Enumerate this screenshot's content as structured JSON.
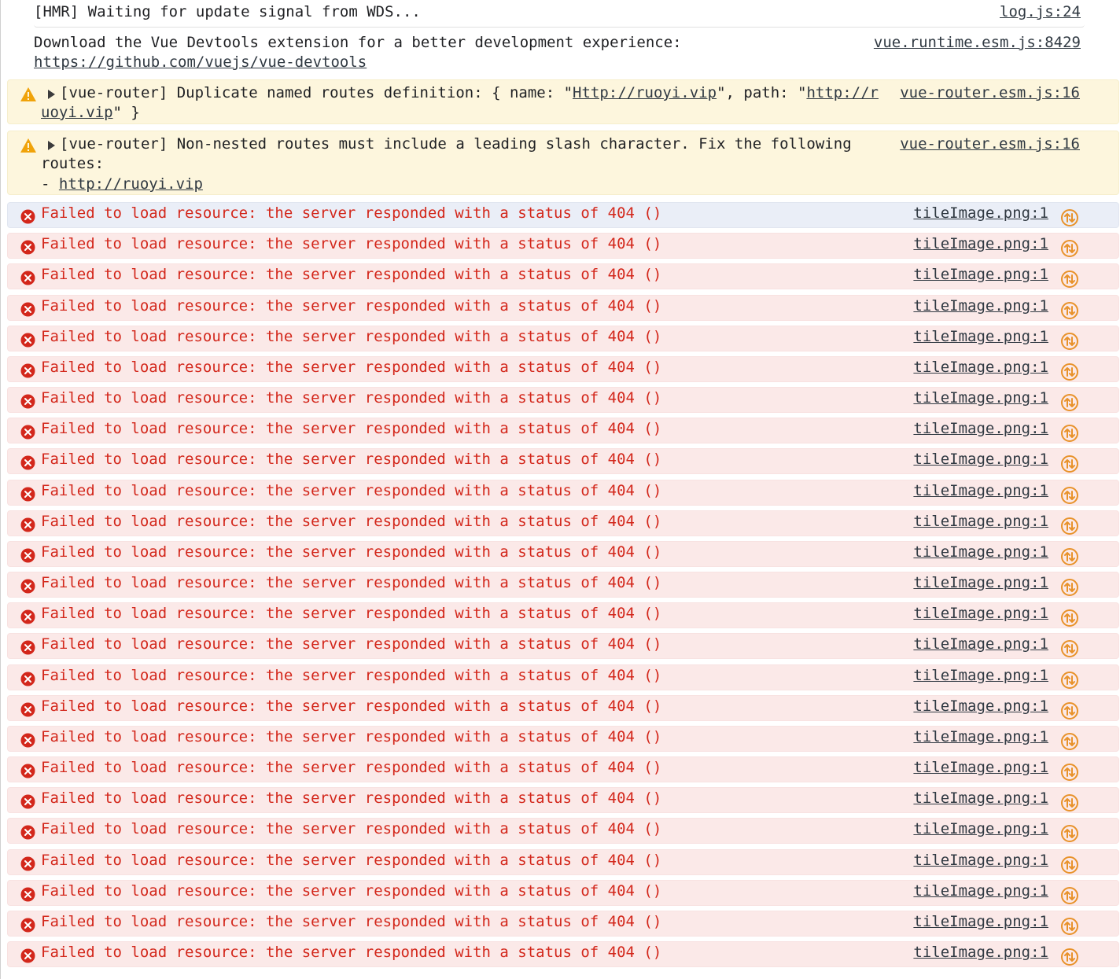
{
  "colors": {
    "error_text": "#d3271b",
    "error_bg": "#fbe9e8",
    "warning_bg": "#fdf6dd",
    "selected_bg": "#eaeef7",
    "warning_icon": "#f0a30a",
    "network_icon": "#e8922a"
  },
  "messages": {
    "hmr": {
      "text": "[HMR] Waiting for update signal from WDS...",
      "source": "log.js:24"
    },
    "devtools": {
      "text": "Download the Vue Devtools extension for a better development experience:",
      "link": "https://github.com/vuejs/vue-devtools",
      "source": "vue.runtime.esm.js:8429"
    },
    "warn_duplicate": {
      "icon": "warning-icon",
      "prefix": "[vue-router] Duplicate named routes definition: { name: \"",
      "link1": "Http://ruoyi.vip",
      "middle": "\", path: \"",
      "link2a": "http://r",
      "link2b": "uoyi.vip",
      "suffix": "\" }",
      "source": "vue-router.esm.js:16"
    },
    "warn_slash": {
      "icon": "warning-icon",
      "line1": "[vue-router] Non-nested routes must include a leading slash character. Fix the following",
      "line2": "routes:",
      "line3_prefix": "- ",
      "line3_link": "http://ruoyi.vip",
      "source": "vue-router.esm.js:16"
    }
  },
  "errors": [
    {
      "text": "Failed to load resource: the server responded with a status of 404 ()",
      "source": "tileImage.png:1"
    },
    {
      "text": "Failed to load resource: the server responded with a status of 404 ()",
      "source": "tileImage.png:1"
    },
    {
      "text": "Failed to load resource: the server responded with a status of 404 ()",
      "source": "tileImage.png:1"
    },
    {
      "text": "Failed to load resource: the server responded with a status of 404 ()",
      "source": "tileImage.png:1"
    },
    {
      "text": "Failed to load resource: the server responded with a status of 404 ()",
      "source": "tileImage.png:1"
    },
    {
      "text": "Failed to load resource: the server responded with a status of 404 ()",
      "source": "tileImage.png:1"
    },
    {
      "text": "Failed to load resource: the server responded with a status of 404 ()",
      "source": "tileImage.png:1"
    },
    {
      "text": "Failed to load resource: the server responded with a status of 404 ()",
      "source": "tileImage.png:1"
    },
    {
      "text": "Failed to load resource: the server responded with a status of 404 ()",
      "source": "tileImage.png:1"
    },
    {
      "text": "Failed to load resource: the server responded with a status of 404 ()",
      "source": "tileImage.png:1"
    },
    {
      "text": "Failed to load resource: the server responded with a status of 404 ()",
      "source": "tileImage.png:1"
    },
    {
      "text": "Failed to load resource: the server responded with a status of 404 ()",
      "source": "tileImage.png:1"
    },
    {
      "text": "Failed to load resource: the server responded with a status of 404 ()",
      "source": "tileImage.png:1"
    },
    {
      "text": "Failed to load resource: the server responded with a status of 404 ()",
      "source": "tileImage.png:1"
    },
    {
      "text": "Failed to load resource: the server responded with a status of 404 ()",
      "source": "tileImage.png:1"
    },
    {
      "text": "Failed to load resource: the server responded with a status of 404 ()",
      "source": "tileImage.png:1"
    },
    {
      "text": "Failed to load resource: the server responded with a status of 404 ()",
      "source": "tileImage.png:1"
    },
    {
      "text": "Failed to load resource: the server responded with a status of 404 ()",
      "source": "tileImage.png:1"
    },
    {
      "text": "Failed to load resource: the server responded with a status of 404 ()",
      "source": "tileImage.png:1"
    },
    {
      "text": "Failed to load resource: the server responded with a status of 404 ()",
      "source": "tileImage.png:1"
    },
    {
      "text": "Failed to load resource: the server responded with a status of 404 ()",
      "source": "tileImage.png:1"
    },
    {
      "text": "Failed to load resource: the server responded with a status of 404 ()",
      "source": "tileImage.png:1"
    },
    {
      "text": "Failed to load resource: the server responded with a status of 404 ()",
      "source": "tileImage.png:1"
    },
    {
      "text": "Failed to load resource: the server responded with a status of 404 ()",
      "source": "tileImage.png:1"
    },
    {
      "text": "Failed to load resource: the server responded with a status of 404 ()",
      "source": "tileImage.png:1"
    }
  ]
}
